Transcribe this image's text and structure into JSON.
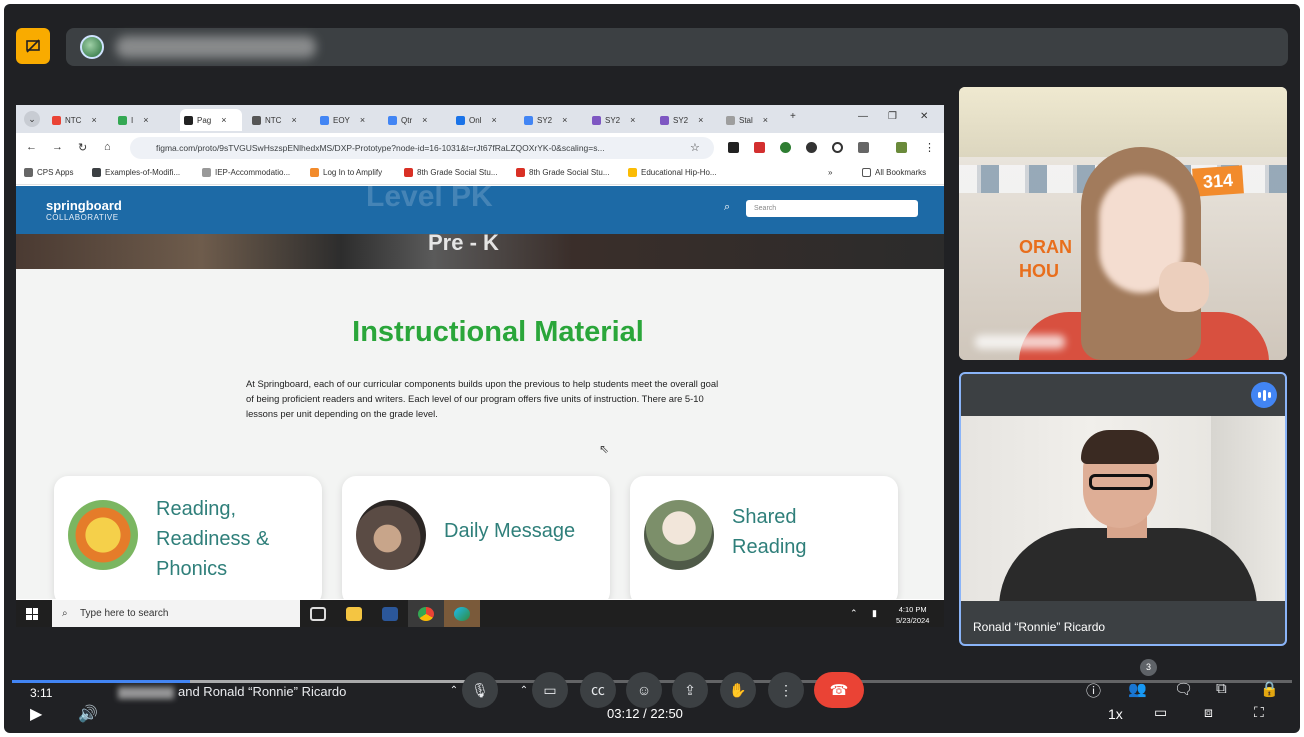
{
  "shared_screen": {
    "tabs": [
      {
        "label": "NTC",
        "color": "#ea4335"
      },
      {
        "label": "I",
        "color": "#34a853"
      },
      {
        "label": "Pag",
        "color": "#222222",
        "active": true
      },
      {
        "label": "NTC",
        "color": "#555555"
      },
      {
        "label": "EOY",
        "color": "#4285f4"
      },
      {
        "label": "Qtr",
        "color": "#4285f4"
      },
      {
        "label": "Onl",
        "color": "#1a73e8"
      },
      {
        "label": "SY2",
        "color": "#4285f4"
      },
      {
        "label": "SY2",
        "color": "#7e57c2"
      },
      {
        "label": "SY2",
        "color": "#7e57c2"
      },
      {
        "label": "Stal",
        "color": "#9e9e9e"
      }
    ],
    "new_tab": "+",
    "url": "figma.com/proto/9sTVGUSwHszspENlhedxMS/DXP-Prototype?node-id=16-1031&t=rJt67fRaLZQOXrYK-0&scaling=s...",
    "bookmarks": [
      "CPS Apps",
      "Examples-of-Modifi...",
      "IEP-Accommodatio...",
      "Log In to Amplify",
      "8th Grade Social Stu...",
      "8th Grade Social Stu...",
      "Educational Hip-Ho..."
    ],
    "bookmarks_more": "»",
    "all_bookmarks": "All Bookmarks",
    "site": {
      "logo_main": "springboard",
      "logo_sub": "COLLABORATIVE",
      "ghost_text": "Level PK",
      "hero_text": "Pre - K",
      "search_placeholder": "Search",
      "title": "Instructional Material",
      "body": "At Springboard, each of our curricular components builds upon the previous to help students meet the overall goal of being proficient readers and writers. Each level of our program offers five units of instruction. There are 5-10 lessons per unit depending on the grade level.",
      "cards": [
        {
          "label": "Reading,\nReadiness &\nPhonics"
        },
        {
          "label": "Daily Message"
        },
        {
          "label": "Shared\nReading"
        }
      ]
    },
    "taskbar": {
      "search_placeholder": "Type here to search",
      "time": "4:10 PM",
      "date": "5/23/2024"
    }
  },
  "participants": [
    {
      "name": "",
      "tile": "teacher-classroom"
    },
    {
      "name": "Ronald “Ronnie” Ricardo",
      "speaking": true
    }
  ],
  "meet_controls": {
    "elapsed": "3:11",
    "names_suffix": "and Ronald “Ronnie” Ricardo",
    "people_count": "3"
  },
  "player": {
    "time": "03:12 / 22:50",
    "speed": "1x",
    "progress_fraction": 0.139
  },
  "colors": {
    "accent_green": "#2aa63a",
    "brand_blue": "#1d6aa6",
    "end_call_red": "#ea4335",
    "meet_bg": "#202124",
    "present_yellow": "#f9ab00"
  }
}
